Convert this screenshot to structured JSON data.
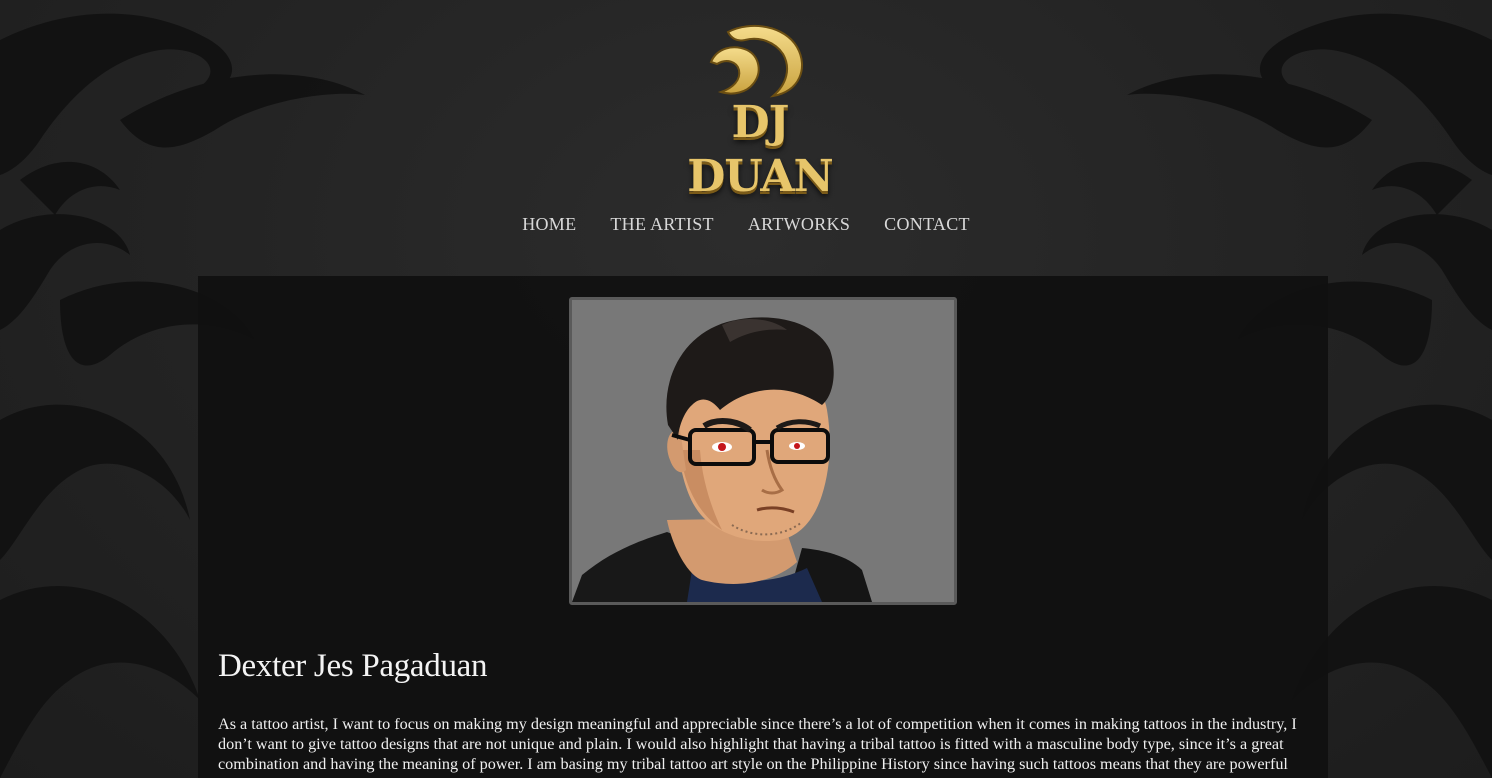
{
  "brand": {
    "logo_text": "DJ DUAN",
    "logo_color": "#e7c56a"
  },
  "nav": {
    "items": [
      {
        "label": "HOME"
      },
      {
        "label": "THE ARTIST"
      },
      {
        "label": "ARTWORKS"
      },
      {
        "label": "CONTACT"
      }
    ]
  },
  "artist": {
    "portrait_icon": "artist-portrait-illustration",
    "name": "Dexter Jes Pagaduan",
    "bio": "As a tattoo artist, I want to focus on making my design meaningful and appreciable since there’s a lot of competition when it comes in making tattoos in the industry, I don’t want to give tattoo designs that are not unique and plain. I would also highlight that having a tribal tattoo is fitted with a masculine body type, since it’s a great combination and having the meaning of power. I am basing my tribal tattoo art style on the Philippine History since having such tattoos means that they are powerful"
  },
  "colors": {
    "background": "#222222",
    "panel": "#101010",
    "nav_text": "#d8d8d8"
  }
}
